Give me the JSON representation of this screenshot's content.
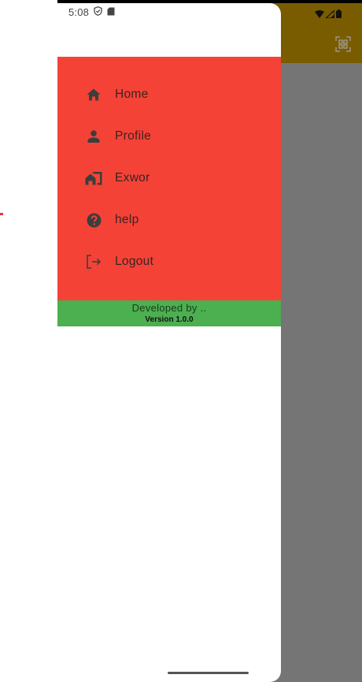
{
  "status_bar": {
    "time": "5:08",
    "icons": [
      "shield-icon",
      "sd-card-icon",
      "wifi-icon",
      "signal-icon",
      "battery-icon"
    ]
  },
  "app_bar": {
    "color": "#7a5c00",
    "action_icon": "qr-scan-icon"
  },
  "drawer": {
    "menu_color": "#f44336",
    "items": [
      {
        "label": "Home",
        "icon": "home-icon"
      },
      {
        "label": "Profile",
        "icon": "person-icon"
      },
      {
        "label": "Exwor",
        "icon": "home-work-icon"
      },
      {
        "label": "help",
        "icon": "help-icon"
      },
      {
        "label": "Logout",
        "icon": "logout-icon"
      }
    ],
    "footer": {
      "color": "#4caf50",
      "developed_by": "Developed by ..",
      "version": "Version 1.0.0"
    }
  }
}
